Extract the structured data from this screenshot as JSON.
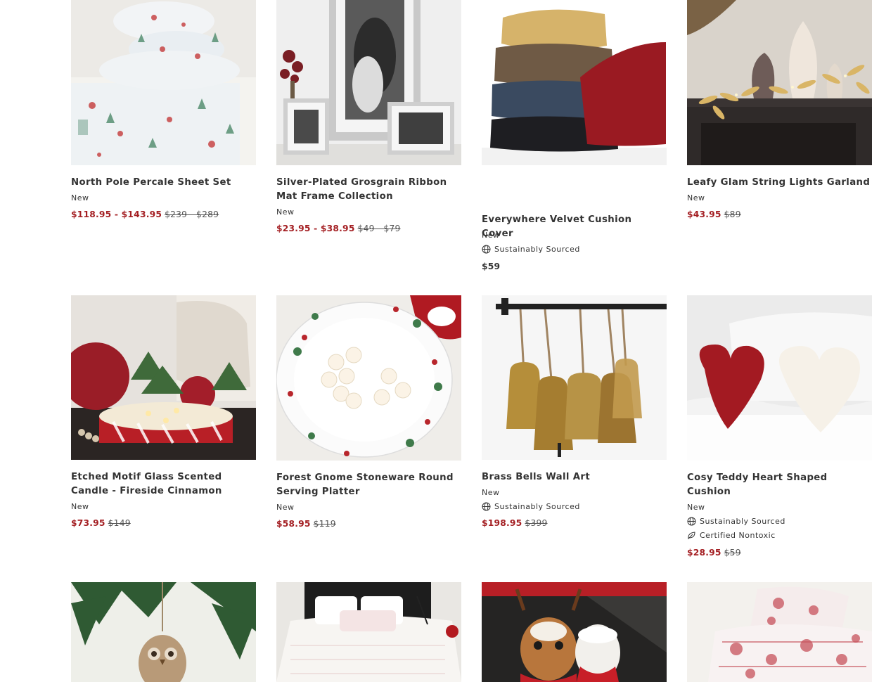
{
  "products": [
    {
      "name": "North Pole Percale Sheet Set",
      "badge": "New",
      "sale_price": "$118.95 - $143.95",
      "original_price": "$239 - $289",
      "image": "holiday-print-sheet-set"
    },
    {
      "name": "Silver-Plated Grosgrain Ribbon Mat Frame Collection",
      "badge": "New",
      "sale_price": "$23.95 - $38.95",
      "original_price": "$49 - $79",
      "image": "silver-photo-frames"
    },
    {
      "name": "Everywhere Velvet Cushion Cover",
      "badge": "New",
      "attributes": [
        "Sustainably Sourced"
      ],
      "regular_price": "$59",
      "image": "stacked-velvet-cushions"
    },
    {
      "name": "Leafy Glam String Lights Garland",
      "badge": "New",
      "sale_price": "$43.95",
      "original_price": "$89",
      "image": "gold-leaf-garland-mantel"
    },
    {
      "name": "Etched Motif Glass Scented Candle - Fireside Cinnamon",
      "badge": "New",
      "sale_price": "$73.95",
      "original_price": "$149",
      "image": "red-striped-candle"
    },
    {
      "name": "Forest Gnome Stoneware Round Serving Platter",
      "badge": "New",
      "sale_price": "$58.95",
      "original_price": "$119",
      "image": "gnome-serving-platter"
    },
    {
      "name": "Brass Bells Wall Art",
      "badge": "New",
      "attributes": [
        "Sustainably Sourced"
      ],
      "sale_price": "$198.95",
      "original_price": "$399",
      "image": "hanging-brass-bells"
    },
    {
      "name": "Cosy Teddy Heart Shaped Cushion",
      "badge": "New",
      "attributes": [
        "Sustainably Sourced",
        "Certified Nontoxic"
      ],
      "sale_price": "$28.95",
      "original_price": "$59",
      "image": "heart-teddy-cushions"
    },
    {
      "image": "knit-owl-ornament"
    },
    {
      "image": "white-bedding-set"
    },
    {
      "image": "reindeer-santa-mugs"
    },
    {
      "image": "red-toile-bedding"
    }
  ],
  "colors": {
    "sale": "#a41f23",
    "text": "#333333",
    "strike": "#555555"
  }
}
